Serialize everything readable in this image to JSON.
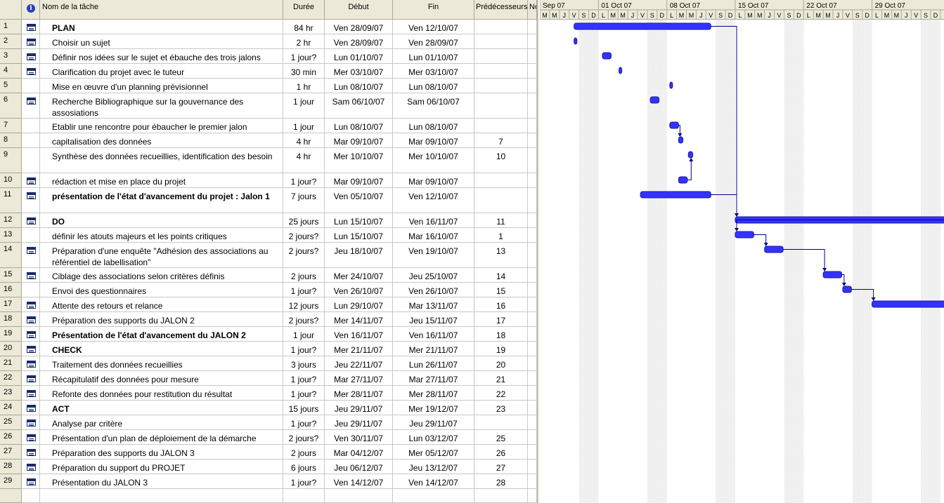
{
  "columns": {
    "info_icon": "info-icon",
    "name": "Nom de la tâche",
    "duration": "Durée",
    "start": "Début",
    "finish": "Fin",
    "predecessors": "Prédécesseurs",
    "next": "No"
  },
  "gantt_weeks": [
    "Sep 07",
    "01 Oct 07",
    "08 Oct 07",
    "15 Oct 07",
    "22 Oct 07",
    "29 Oct 07"
  ],
  "gantt_days": [
    "M",
    "M",
    "J",
    "V",
    "S",
    "D",
    "L",
    "M",
    "M",
    "J",
    "V",
    "S",
    "D",
    "L",
    "M",
    "M",
    "J",
    "V",
    "S",
    "D",
    "L",
    "M",
    "M",
    "J",
    "V",
    "S",
    "D",
    "L",
    "M",
    "M",
    "J",
    "V",
    "S",
    "D",
    "L",
    "M",
    "M",
    "J",
    "V",
    "S",
    "D",
    "L",
    "M",
    "M",
    "J",
    "V",
    "S",
    "D"
  ],
  "colors": {
    "bar": "#3333ff",
    "bar_dark": "#1a1aa0",
    "link": "#00008b",
    "header_bg": "#ece9d8",
    "weekend": "#b0b0b0"
  },
  "tasks": [
    {
      "id": "1",
      "note": true,
      "name": "PLAN",
      "bold": true,
      "duration": "84 hr",
      "start": "Ven 28/09/07",
      "finish": "Ven 12/10/07",
      "pred": "",
      "bar": {
        "s": 3.5,
        "e": 17.5,
        "type": "summary"
      }
    },
    {
      "id": "2",
      "note": true,
      "name": "Choisir un sujet",
      "bold": false,
      "duration": "2 hr",
      "start": "Ven 28/09/07",
      "finish": "Ven 28/09/07",
      "pred": "",
      "bar": {
        "s": 3.5,
        "e": 3.8,
        "type": "task"
      }
    },
    {
      "id": "3",
      "note": true,
      "name": "Définir nos idées sur le sujet et ébauche des trois jalons",
      "bold": false,
      "duration": "1 jour?",
      "start": "Lun 01/10/07",
      "finish": "Lun 01/10/07",
      "pred": "",
      "bar": {
        "s": 6.4,
        "e": 7.3,
        "type": "task"
      }
    },
    {
      "id": "4",
      "note": true,
      "name": "Clarification du projet avec le tuteur",
      "bold": false,
      "duration": "30 min",
      "start": "Mer 03/10/07",
      "finish": "Mer 03/10/07",
      "pred": "",
      "bar": {
        "s": 8.1,
        "e": 8.35,
        "type": "task"
      }
    },
    {
      "id": "5",
      "note": false,
      "name": "Mise en œuvre d'un planning prévisionnel",
      "bold": false,
      "duration": "1 hr",
      "start": "Lun 08/10/07",
      "finish": "Lun 08/10/07",
      "pred": "",
      "bar": {
        "s": 13.3,
        "e": 13.5,
        "type": "task"
      }
    },
    {
      "id": "6",
      "note": true,
      "name": "Recherche Bibliographique sur la gouvernance des assosiations",
      "bold": false,
      "duration": "1 jour",
      "start": "Sam 06/10/07",
      "finish": "Sam 06/10/07",
      "pred": "",
      "bar": {
        "s": 11.3,
        "e": 12.2,
        "type": "task"
      }
    },
    {
      "id": "7",
      "note": false,
      "name": "Etablir une rencontre pour ébaucher le premier jalon",
      "bold": false,
      "duration": "1 jour",
      "start": "Lun 08/10/07",
      "finish": "Lun 08/10/07",
      "pred": "",
      "bar": {
        "s": 13.3,
        "e": 14.2,
        "type": "task"
      }
    },
    {
      "id": "8",
      "note": false,
      "name": "capitalisation des données",
      "bold": false,
      "duration": "4 hr",
      "start": "Mar 09/10/07",
      "finish": "Mar 09/10/07",
      "pred": "7",
      "bar": {
        "s": 14.2,
        "e": 14.65,
        "type": "task"
      }
    },
    {
      "id": "9",
      "note": false,
      "name": "Synthèse des données recueillies, identification des besoin",
      "bold": false,
      "duration": "4 hr",
      "start": "Mer 10/10/07",
      "finish": "Mer 10/10/07",
      "pred": "10",
      "bar": {
        "s": 15.2,
        "e": 15.65,
        "type": "task"
      }
    },
    {
      "id": "10",
      "note": true,
      "name": "rédaction et mise en place du projet",
      "bold": false,
      "duration": "1 jour?",
      "start": "Mar 09/10/07",
      "finish": "Mar 09/10/07",
      "pred": "",
      "bar": {
        "s": 14.2,
        "e": 15.1,
        "type": "task"
      }
    },
    {
      "id": "11",
      "note": true,
      "name": "présentation de l'état d'avancement du projet : Jalon 1",
      "bold": true,
      "duration": "7 jours",
      "start": "Ven 05/10/07",
      "finish": "Ven 12/10/07",
      "pred": "",
      "bar": {
        "s": 10.3,
        "e": 17.5,
        "type": "summary"
      }
    },
    {
      "id": "12",
      "note": true,
      "name": "DO",
      "bold": true,
      "duration": "25 jours",
      "start": "Lun 15/10/07",
      "finish": "Ven 16/11/07",
      "pred": "11",
      "bar": {
        "s": 20.0,
        "e": 60,
        "type": "summary"
      }
    },
    {
      "id": "13",
      "note": false,
      "name": "définir les atouts majeurs et les points critiques",
      "bold": false,
      "duration": "2 jours?",
      "start": "Lun 15/10/07",
      "finish": "Mar 16/10/07",
      "pred": "1",
      "bar": {
        "s": 20.0,
        "e": 21.9,
        "type": "task"
      }
    },
    {
      "id": "14",
      "note": true,
      "name": "Préparation d'une enquête \"Adhésion des associations au référentiel de labellisation\"",
      "bold": false,
      "duration": "2 jours?",
      "start": "Jeu 18/10/07",
      "finish": "Ven 19/10/07",
      "pred": "13",
      "bar": {
        "s": 23.0,
        "e": 24.9,
        "type": "task"
      }
    },
    {
      "id": "15",
      "note": true,
      "name": "Ciblage des associations selon critères définis",
      "bold": false,
      "duration": "2 jours",
      "start": "Mer 24/10/07",
      "finish": "Jeu 25/10/07",
      "pred": "14",
      "bar": {
        "s": 29.0,
        "e": 30.9,
        "type": "task"
      }
    },
    {
      "id": "16",
      "note": false,
      "name": "Envoi des questionnaires",
      "bold": false,
      "duration": "1 jour?",
      "start": "Ven 26/10/07",
      "finish": "Ven 26/10/07",
      "pred": "15",
      "bar": {
        "s": 31.0,
        "e": 31.9,
        "type": "task"
      }
    },
    {
      "id": "17",
      "note": true,
      "name": "Attente des retours et relance",
      "bold": false,
      "duration": "12 jours",
      "start": "Lun 29/10/07",
      "finish": "Mar 13/11/07",
      "pred": "16",
      "bar": {
        "s": 34.0,
        "e": 60,
        "type": "task"
      }
    },
    {
      "id": "18",
      "note": true,
      "name": "Préparation des supports du JALON 2",
      "bold": false,
      "duration": "2 jours?",
      "start": "Mer 14/11/07",
      "finish": "Jeu 15/11/07",
      "pred": "17",
      "bar": null
    },
    {
      "id": "19",
      "note": true,
      "name": "Présentation  de l'état d'avancement du  JALON 2",
      "bold": true,
      "duration": "1 jour",
      "start": "Ven 16/11/07",
      "finish": "Ven 16/11/07",
      "pred": "18",
      "bar": null
    },
    {
      "id": "20",
      "note": true,
      "name": "CHECK",
      "bold": true,
      "duration": "1 jour?",
      "start": "Mer 21/11/07",
      "finish": "Mer 21/11/07",
      "pred": "19",
      "bar": null
    },
    {
      "id": "21",
      "note": true,
      "name": "Traitement des données recueillies",
      "bold": false,
      "duration": "3 jours",
      "start": "Jeu 22/11/07",
      "finish": "Lun 26/11/07",
      "pred": "20",
      "bar": null
    },
    {
      "id": "22",
      "note": true,
      "name": "Récapitulatif des données pour mesure",
      "bold": false,
      "duration": "1 jour?",
      "start": "Mar 27/11/07",
      "finish": "Mar 27/11/07",
      "pred": "21",
      "bar": null
    },
    {
      "id": "23",
      "note": true,
      "name": "Refonte des données pour restitution du résultat",
      "bold": false,
      "duration": "1 jour?",
      "start": "Mer 28/11/07",
      "finish": "Mer 28/11/07",
      "pred": "22",
      "bar": null
    },
    {
      "id": "24",
      "note": true,
      "name": "ACT",
      "bold": true,
      "duration": "15 jours",
      "start": "Jeu 29/11/07",
      "finish": "Mer 19/12/07",
      "pred": "23",
      "bar": null
    },
    {
      "id": "25",
      "note": true,
      "name": "Analyse par critère",
      "bold": false,
      "duration": "1 jour?",
      "start": "Jeu 29/11/07",
      "finish": "Jeu 29/11/07",
      "pred": "",
      "bar": null
    },
    {
      "id": "26",
      "note": true,
      "name": "Présentation d'un plan de déploiement de la démarche",
      "bold": false,
      "duration": "2 jours?",
      "start": "Ven 30/11/07",
      "finish": "Lun 03/12/07",
      "pred": "25",
      "bar": null
    },
    {
      "id": "27",
      "note": true,
      "name": "Préparation des supports du JALON 3",
      "bold": false,
      "duration": "2 jours",
      "start": "Mar 04/12/07",
      "finish": "Mer 05/12/07",
      "pred": "26",
      "bar": null
    },
    {
      "id": "28",
      "note": true,
      "name": "Préparation du support du PROJET",
      "bold": false,
      "duration": "6 jours",
      "start": "Jeu 06/12/07",
      "finish": "Jeu 13/12/07",
      "pred": "27",
      "bar": null
    },
    {
      "id": "29",
      "note": true,
      "name": "Présentation du JALON 3",
      "bold": false,
      "duration": "1 jour?",
      "start": "Ven 14/12/07",
      "finish": "Ven 14/12/07",
      "pred": "28",
      "bar": null
    }
  ],
  "links": [
    {
      "from": "1",
      "to": "12"
    },
    {
      "from": "7",
      "to": "8"
    },
    {
      "from": "10",
      "to": "9"
    },
    {
      "from": "11",
      "to": "12"
    },
    {
      "from": "12",
      "to": "13"
    },
    {
      "from": "13",
      "to": "14"
    },
    {
      "from": "14",
      "to": "15"
    },
    {
      "from": "15",
      "to": "16"
    },
    {
      "from": "16",
      "to": "17"
    }
  ]
}
